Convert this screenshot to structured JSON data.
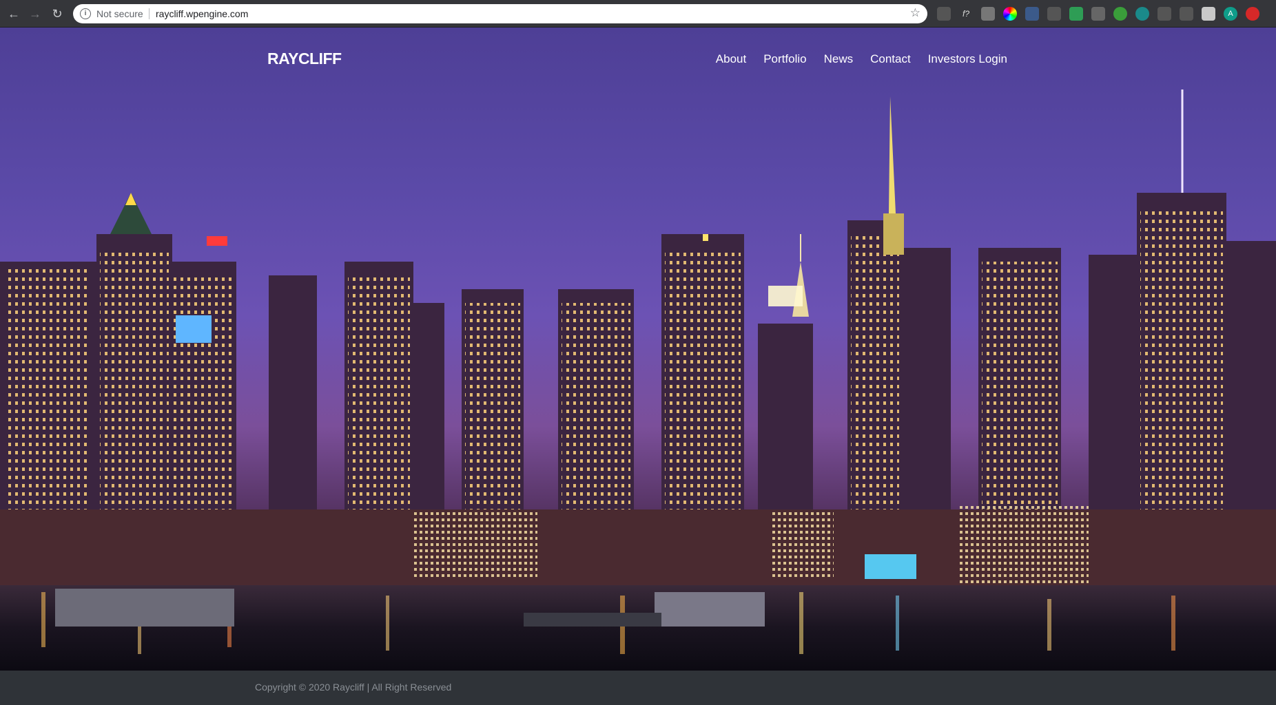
{
  "browser": {
    "security_label": "Not secure",
    "url": "raycliff.wpengine.com",
    "profile_initial": "A"
  },
  "site": {
    "brand": "RAYCLIFF",
    "nav": [
      "About",
      "Portfolio",
      "News",
      "Contact",
      "Investors Login"
    ]
  },
  "footer": {
    "copyright": "Copyright  © 2020  Raycliff | All Right Reserved"
  },
  "icons": {
    "back": "back-arrow-icon",
    "forward": "forward-arrow-icon",
    "reload": "reload-icon",
    "info": "info-icon",
    "bookmark": "star-icon"
  },
  "colors": {
    "sky": "#5b4aa8",
    "footer_bg": "#2f3338",
    "footer_text": "#8a8f95"
  }
}
